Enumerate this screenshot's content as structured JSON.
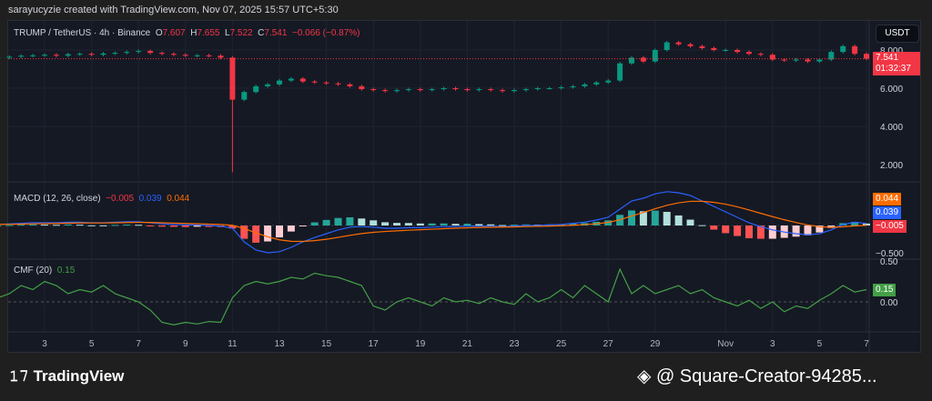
{
  "credit": "sarayucyzie created with TradingView.com, Nov 07, 2025 15:57 UTC+5:30",
  "legend": {
    "symbol": "TRUMP / TetherUS · 4h · Binance",
    "o_label": "O",
    "o": "7.607",
    "h_label": "H",
    "h": "7.655",
    "l_label": "L",
    "l": "7.522",
    "c_label": "C",
    "c": "7.541",
    "change": "−0.066 (−0.87%)"
  },
  "currency": "USDT",
  "last_price": "7.541",
  "countdown": "01:32:37",
  "macd_legend": {
    "name": "MACD (12, 26, close)",
    "hist": "−0.005",
    "macd": "0.039",
    "signal": "0.044"
  },
  "cmf_legend": {
    "name": "CMF (20)",
    "value": "0.15"
  },
  "footer": {
    "logo": "TradingView",
    "user": "@ Square-Creator-94285..."
  },
  "colors": {
    "up": "#089981",
    "down": "#f23645",
    "macd": "#2962ff",
    "signal": "#ff6d00",
    "cmf": "#43a047"
  },
  "chart_data": [
    {
      "type": "candlestick",
      "title": "TRUMP / TetherUS 4h",
      "start_day": 1,
      "step_days": 0.5,
      "closes": [
        7.6,
        7.65,
        7.7,
        7.72,
        7.75,
        7.7,
        7.78,
        7.8,
        7.75,
        7.82,
        7.85,
        7.9,
        7.95,
        7.85,
        7.8,
        7.75,
        7.7,
        7.72,
        7.7,
        7.6,
        5.4,
        5.8,
        6.1,
        6.2,
        6.4,
        6.5,
        6.35,
        6.3,
        6.25,
        6.2,
        6.1,
        5.95,
        5.9,
        5.85,
        5.9,
        5.95,
        5.9,
        5.95,
        6.0,
        5.95,
        5.9,
        5.95,
        5.9,
        5.85,
        5.9,
        5.95,
        6.0,
        6.0,
        6.05,
        6.1,
        6.2,
        6.3,
        6.4,
        7.3,
        7.6,
        7.4,
        8.0,
        8.4,
        8.3,
        8.2,
        8.1,
        8.0,
        8.0,
        7.9,
        7.8,
        7.75,
        7.5,
        7.45,
        7.5,
        7.4,
        7.5,
        7.9,
        8.2,
        7.8,
        7.541
      ],
      "wick_override": {
        "index": 20,
        "low": 1.6
      },
      "y_ticks": [
        "8.000",
        "6.000",
        "4.000",
        "2.000"
      ],
      "ylim": [
        1.2,
        9.2
      ]
    },
    {
      "type": "macd",
      "series": [
        0.02,
        0.03,
        0.04,
        0.05,
        0.05,
        0.05,
        0.06,
        0.06,
        0.05,
        0.05,
        0.06,
        0.07,
        0.07,
        0.05,
        0.03,
        0.02,
        0.01,
        0.01,
        0.0,
        -0.01,
        -0.05,
        -0.3,
        -0.45,
        -0.5,
        -0.48,
        -0.4,
        -0.3,
        -0.22,
        -0.15,
        -0.08,
        -0.03,
        -0.02,
        -0.03,
        -0.05,
        -0.05,
        -0.04,
        -0.04,
        -0.03,
        -0.02,
        -0.02,
        -0.01,
        -0.01,
        -0.01,
        -0.02,
        -0.01,
        0,
        0,
        0.01,
        0.02,
        0.04,
        0.06,
        0.1,
        0.15,
        0.3,
        0.45,
        0.5,
        0.58,
        0.62,
        0.6,
        0.55,
        0.45,
        0.35,
        0.25,
        0.15,
        0.05,
        -0.02,
        -0.08,
        -0.12,
        -0.15,
        -0.17,
        -0.15,
        -0.08,
        0.02,
        0.06,
        0.039
      ],
      "y_ticks": [
        "−0.500"
      ]
    },
    {
      "type": "line",
      "name": "CMF (20)",
      "series": [
        0.05,
        0.1,
        0.2,
        0.15,
        0.25,
        0.2,
        0.1,
        0.15,
        0.12,
        0.2,
        0.1,
        0.05,
        0.0,
        -0.1,
        -0.25,
        -0.28,
        -0.25,
        -0.27,
        -0.24,
        -0.25,
        0.05,
        0.2,
        0.25,
        0.22,
        0.25,
        0.3,
        0.28,
        0.35,
        0.32,
        0.3,
        0.25,
        0.2,
        -0.05,
        -0.1,
        0.0,
        0.05,
        0.0,
        -0.05,
        0.05,
        0.0,
        0.02,
        -0.02,
        0.05,
        0.0,
        -0.03,
        0.1,
        0.0,
        0.05,
        0.15,
        0.05,
        0.2,
        0.1,
        0.0,
        0.4,
        0.1,
        0.2,
        0.1,
        0.15,
        0.2,
        0.1,
        0.15,
        0.05,
        0.0,
        -0.05,
        0.02,
        -0.08,
        0.0,
        -0.12,
        -0.05,
        -0.08,
        0.02,
        0.1,
        0.2,
        0.12,
        0.15
      ],
      "y_ticks": [
        "0.50",
        "0.00"
      ]
    }
  ],
  "x_ticks": [
    {
      "day": 3,
      "label": "3"
    },
    {
      "day": 5,
      "label": "5"
    },
    {
      "day": 7,
      "label": "7"
    },
    {
      "day": 9,
      "label": "9"
    },
    {
      "day": 11,
      "label": "11"
    },
    {
      "day": 13,
      "label": "13"
    },
    {
      "day": 15,
      "label": "15"
    },
    {
      "day": 17,
      "label": "17"
    },
    {
      "day": 19,
      "label": "19"
    },
    {
      "day": 21,
      "label": "21"
    },
    {
      "day": 23,
      "label": "23"
    },
    {
      "day": 25,
      "label": "25"
    },
    {
      "day": 27,
      "label": "27"
    },
    {
      "day": 29,
      "label": "29"
    },
    {
      "day": 32,
      "label": "Nov"
    },
    {
      "day": 34,
      "label": "3"
    },
    {
      "day": 36,
      "label": "5"
    },
    {
      "day": 38,
      "label": "7"
    }
  ]
}
